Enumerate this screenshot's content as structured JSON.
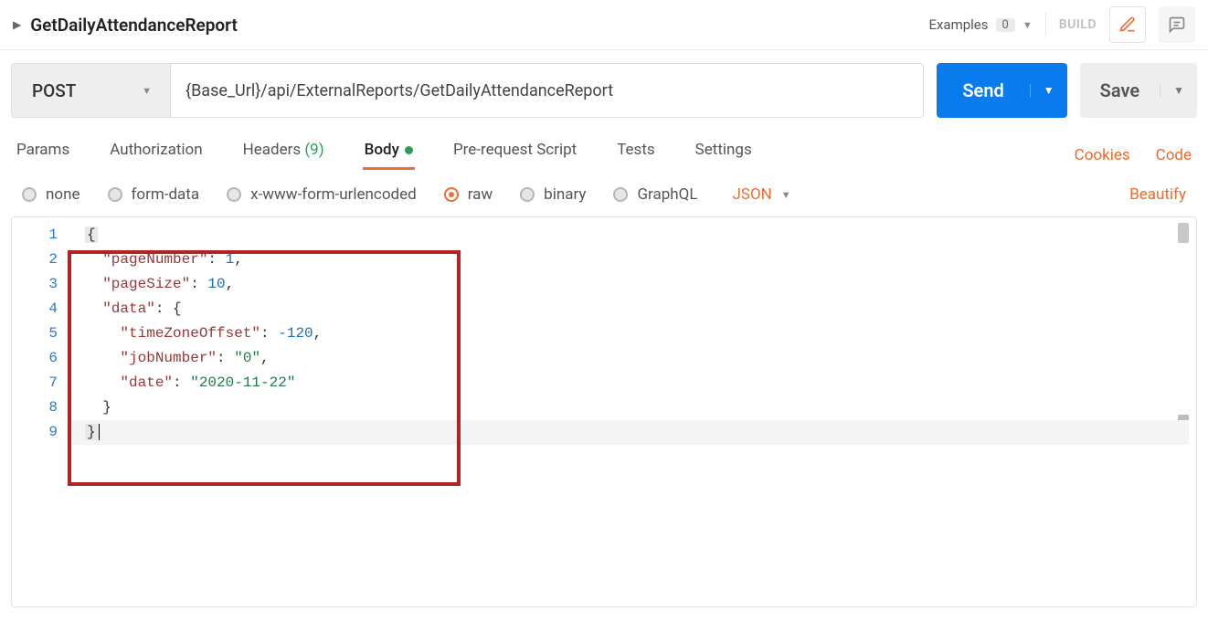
{
  "header": {
    "title": "GetDailyAttendanceReport",
    "examples_label": "Examples",
    "examples_count": "0",
    "build_label": "BUILD"
  },
  "request": {
    "method": "POST",
    "url": "{Base_Url}/api/ExternalReports/GetDailyAttendanceReport",
    "send_label": "Send",
    "save_label": "Save"
  },
  "tabs": {
    "params": "Params",
    "authorization": "Authorization",
    "headers": "Headers",
    "headers_count": "(9)",
    "body": "Body",
    "prerequest": "Pre-request Script",
    "tests": "Tests",
    "settings": "Settings",
    "cookies": "Cookies",
    "code": "Code"
  },
  "body_options": {
    "none": "none",
    "formdata": "form-data",
    "xwww": "x-www-form-urlencoded",
    "raw": "raw",
    "binary": "binary",
    "graphql": "GraphQL",
    "type": "JSON",
    "beautify": "Beautify"
  },
  "editor": {
    "line_numbers": [
      "1",
      "2",
      "3",
      "4",
      "5",
      "6",
      "7",
      "8",
      "9"
    ],
    "body_json": {
      "pageNumber": 1,
      "pageSize": 10,
      "data": {
        "timeZoneOffset": -120,
        "jobNumber": "0",
        "date": "2020-11-22"
      }
    }
  }
}
